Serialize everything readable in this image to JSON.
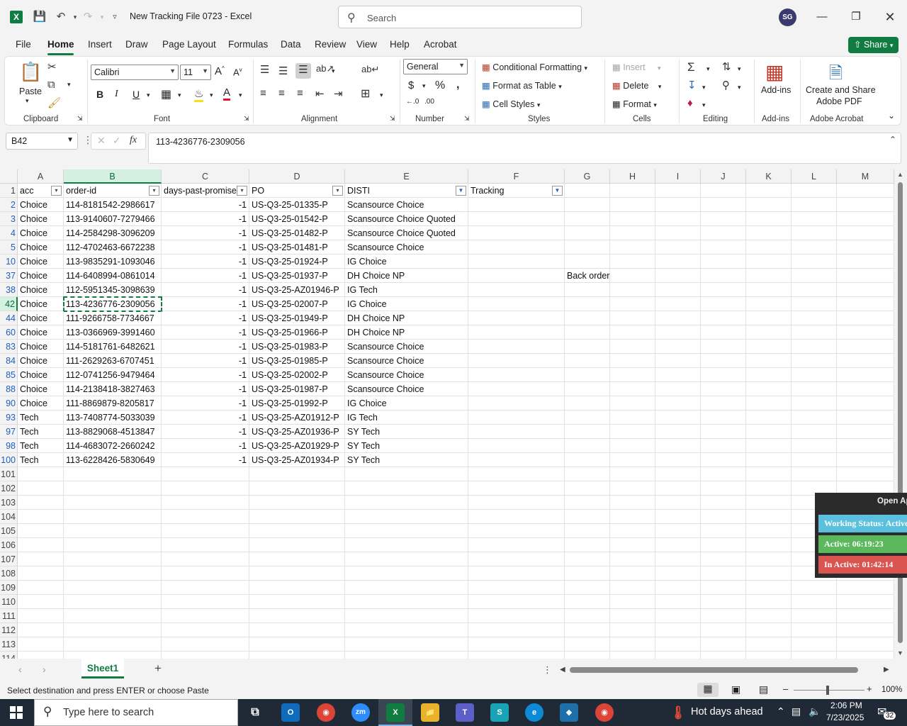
{
  "app": {
    "title": "New Tracking File 0723  -  Excel",
    "search_placeholder": "Search",
    "user_initials": "SG"
  },
  "ribbon_tabs": [
    "File",
    "Home",
    "Insert",
    "Draw",
    "Page Layout",
    "Formulas",
    "Data",
    "Review",
    "View",
    "Help",
    "Acrobat"
  ],
  "share_label": "Share",
  "ribbon": {
    "paste": "Paste",
    "font_name": "Calibri",
    "font_size": "11",
    "number_format": "General",
    "conditional_formatting": "Conditional Formatting",
    "format_as_table": "Format as Table",
    "cell_styles": "Cell Styles",
    "insert": "Insert",
    "delete": "Delete",
    "format": "Format",
    "addins": "Add-ins",
    "create_share_pdf_1": "Create and Share",
    "create_share_pdf_2": "Adobe PDF",
    "groups": {
      "clipboard": "Clipboard",
      "font": "Font",
      "alignment": "Alignment",
      "number": "Number",
      "styles": "Styles",
      "cells": "Cells",
      "editing": "Editing",
      "addins": "Add-ins",
      "acrobat": "Adobe Acrobat"
    }
  },
  "formula_bar": {
    "name_box": "B42",
    "formula": "113-4236776-2309056"
  },
  "columns": [
    "A",
    "B",
    "C",
    "D",
    "E",
    "F",
    "G",
    "H",
    "I",
    "J",
    "K",
    "L",
    "M"
  ],
  "headers": [
    "acc",
    "order-id",
    "days-past-promise",
    "PO",
    "DISTI",
    "Tracking"
  ],
  "rows": [
    {
      "n": "2",
      "acc": "Choice",
      "order": "114-8181542-2986617",
      "days": "-1",
      "po": "US-Q3-25-01335-P",
      "disti": "Scansource Choice",
      "g": ""
    },
    {
      "n": "3",
      "acc": "Choice",
      "order": "113-9140607-7279466",
      "days": "-1",
      "po": "US-Q3-25-01542-P",
      "disti": "Scansource Choice Quoted",
      "g": ""
    },
    {
      "n": "4",
      "acc": "Choice",
      "order": "114-2584298-3096209",
      "days": "-1",
      "po": "US-Q3-25-01482-P",
      "disti": "Scansource Choice Quoted",
      "g": ""
    },
    {
      "n": "5",
      "acc": "Choice",
      "order": "112-4702463-6672238",
      "days": "-1",
      "po": "US-Q3-25-01481-P",
      "disti": "Scansource Choice",
      "g": ""
    },
    {
      "n": "10",
      "acc": "Choice",
      "order": "113-9835291-1093046",
      "days": "-1",
      "po": "US-Q3-25-01924-P",
      "disti": "IG Choice",
      "g": ""
    },
    {
      "n": "37",
      "acc": "Choice",
      "order": "114-6408994-0861014",
      "days": "-1",
      "po": "US-Q3-25-01937-P",
      "disti": "DH Choice NP",
      "g": "Back order"
    },
    {
      "n": "38",
      "acc": "Choice",
      "order": "112-5951345-3098639",
      "days": "-1",
      "po": "US-Q3-25-AZ01946-P",
      "disti": "IG Tech",
      "g": ""
    },
    {
      "n": "42",
      "acc": "Choice",
      "order": "113-4236776-2309056",
      "days": "-1",
      "po": "US-Q3-25-02007-P",
      "disti": "IG Choice",
      "g": ""
    },
    {
      "n": "44",
      "acc": "Choice",
      "order": "111-9266758-7734667",
      "days": "-1",
      "po": "US-Q3-25-01949-P",
      "disti": "DH Choice NP",
      "g": ""
    },
    {
      "n": "60",
      "acc": "Choice",
      "order": "113-0366969-3991460",
      "days": "-1",
      "po": "US-Q3-25-01966-P",
      "disti": "DH Choice NP",
      "g": ""
    },
    {
      "n": "83",
      "acc": "Choice",
      "order": "114-5181761-6482621",
      "days": "-1",
      "po": "US-Q3-25-01983-P",
      "disti": "Scansource Choice",
      "g": ""
    },
    {
      "n": "84",
      "acc": "Choice",
      "order": "111-2629263-6707451",
      "days": "-1",
      "po": "US-Q3-25-01985-P",
      "disti": "Scansource Choice",
      "g": ""
    },
    {
      "n": "85",
      "acc": "Choice",
      "order": "112-0741256-9479464",
      "days": "-1",
      "po": "US-Q3-25-02002-P",
      "disti": "Scansource Choice",
      "g": ""
    },
    {
      "n": "88",
      "acc": "Choice",
      "order": "114-2138418-3827463",
      "days": "-1",
      "po": "US-Q3-25-01987-P",
      "disti": "Scansource Choice",
      "g": ""
    },
    {
      "n": "90",
      "acc": "Choice",
      "order": "111-8869879-8205817",
      "days": "-1",
      "po": "US-Q3-25-01992-P",
      "disti": "IG Choice",
      "g": ""
    },
    {
      "n": "93",
      "acc": "Tech",
      "order": "113-7408774-5033039",
      "days": "-1",
      "po": "US-Q3-25-AZ01912-P",
      "disti": "IG Tech",
      "g": ""
    },
    {
      "n": "97",
      "acc": "Tech",
      "order": "113-8829068-4513847",
      "days": "-1",
      "po": "US-Q3-25-AZ01936-P",
      "disti": "SY Tech",
      "g": ""
    },
    {
      "n": "98",
      "acc": "Tech",
      "order": "114-4683072-2660242",
      "days": "-1",
      "po": "US-Q3-25-AZ01929-P",
      "disti": "SY Tech",
      "g": ""
    },
    {
      "n": "100",
      "acc": "Tech",
      "order": "113-6228426-5830649",
      "days": "-1",
      "po": "US-Q3-25-AZ01934-P",
      "disti": "SY Tech",
      "g": ""
    }
  ],
  "empty_rows": [
    "101",
    "102",
    "103",
    "104",
    "105",
    "106",
    "107",
    "108",
    "109",
    "110",
    "111",
    "112",
    "113",
    "114"
  ],
  "sheet_tab": "Sheet1",
  "status_text": "Select destination and press ENTER or choose Paste",
  "zoom": "100%",
  "overlay": {
    "open": "Open Ap",
    "working": "Working Status: Active",
    "active": "Active: 06:19:23",
    "inactive": "In Active: 01:42:14"
  },
  "taskbar": {
    "search_placeholder": "Type here to search",
    "weather": "Hot days ahead",
    "time": "2:06 PM",
    "date": "7/23/2025",
    "notifications": "32"
  },
  "colors": {
    "excel_green": "#107c41",
    "overlay_blue": "#5bc0de",
    "overlay_green": "#5cb85c",
    "overlay_red": "#d9534f"
  }
}
